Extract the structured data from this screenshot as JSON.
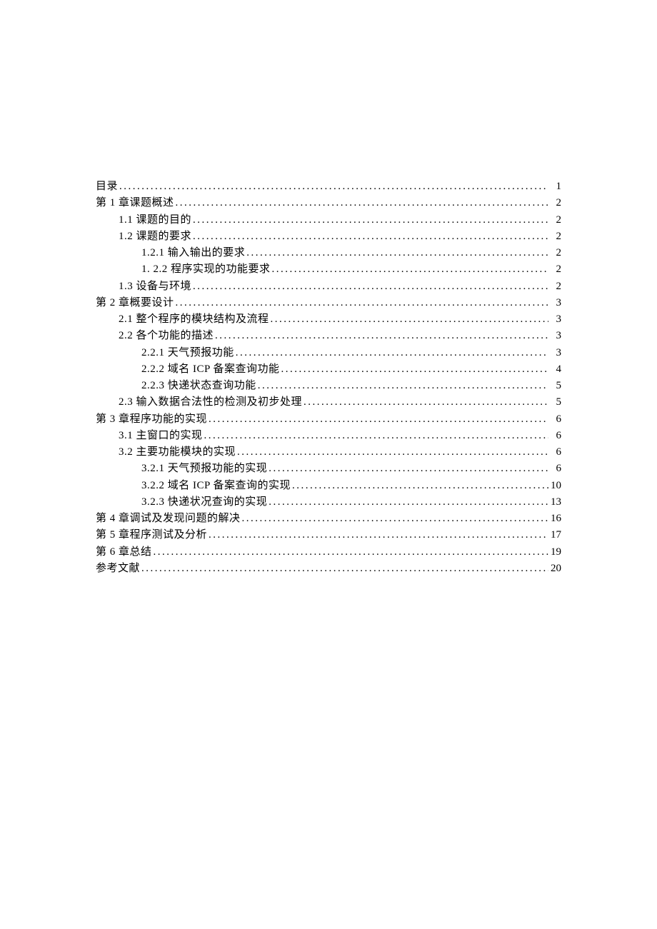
{
  "toc": [
    {
      "label": "目录",
      "page": "1",
      "indent": 0
    },
    {
      "label": "第 1 章课题概述",
      "page": "2",
      "indent": 0
    },
    {
      "label": "1.1 课题的目的",
      "page": "2",
      "indent": 1
    },
    {
      "label": "1.2 课题的要求",
      "page": "2",
      "indent": 1
    },
    {
      "label": "1.2.1 输入输出的要求",
      "page": "2",
      "indent": 2
    },
    {
      "label": "1.  2.2 程序实现的功能要求",
      "page": "2",
      "indent": 2
    },
    {
      "label": "1.3 设备与环境",
      "page": "2",
      "indent": 1
    },
    {
      "label": "第 2 章概要设计",
      "page": "3",
      "indent": 0
    },
    {
      "label": "2.1 整个程序的模块结构及流程",
      "page": "3",
      "indent": 1
    },
    {
      "label": "2.2 各个功能的描述",
      "page": "3",
      "indent": 1
    },
    {
      "label": "2.2.1 天气预报功能",
      "page": "3",
      "indent": 2
    },
    {
      "label": "2.2.2 域名 ICP 备案查询功能",
      "page": "4",
      "indent": 2
    },
    {
      "label": "2.2.3 快递状态查询功能",
      "page": "5",
      "indent": 2
    },
    {
      "label": "2.3 输入数据合法性的检测及初步处理",
      "page": "5",
      "indent": 1
    },
    {
      "label": "第 3 章程序功能的实现",
      "page": "6",
      "indent": 0
    },
    {
      "label": "3.1 主窗口的实现",
      "page": "6",
      "indent": 1
    },
    {
      "label": "3.2 主要功能模块的实现",
      "page": "6",
      "indent": 1
    },
    {
      "label": "3.2.1 天气预报功能的实现",
      "page": "6",
      "indent": 2
    },
    {
      "label": "3.2.2 域名 ICP 备案查询的实现",
      "page": "10",
      "indent": 2
    },
    {
      "label": "3.2.3 快递状况查询的实现",
      "page": "13",
      "indent": 2
    },
    {
      "label": "第 4 章调试及发现问题的解决",
      "page": "16",
      "indent": 0
    },
    {
      "label": "第 5 章程序测试及分析",
      "page": "17",
      "indent": 0
    },
    {
      "label": "第 6 章总结",
      "page": "19",
      "indent": 0
    },
    {
      "label": "参考文献",
      "page": "20",
      "indent": 0
    }
  ]
}
